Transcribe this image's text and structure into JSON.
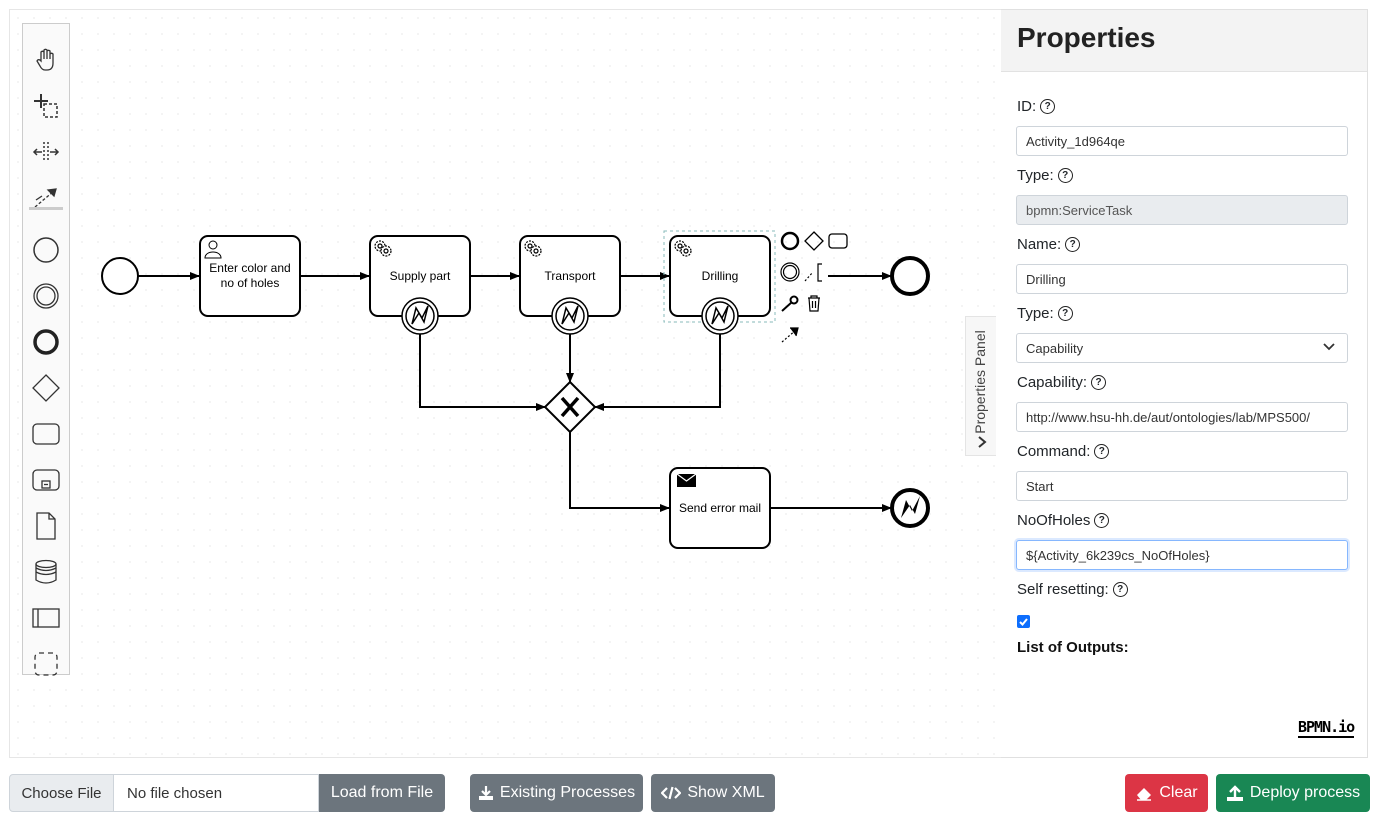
{
  "diagram": {
    "tasks": [
      {
        "label_line1": "Enter color and",
        "label_line2": "no of holes"
      },
      {
        "label": "Supply part"
      },
      {
        "label": "Transport"
      },
      {
        "label": "Drilling"
      },
      {
        "label": "Send error mail"
      }
    ],
    "gateway_symbol": "X"
  },
  "side_tab": {
    "label": "Properties Panel"
  },
  "properties": {
    "title": "Properties",
    "id_label": "ID:",
    "id_value": "Activity_1d964qe",
    "type_label": "Type:",
    "type_value": "bpmn:ServiceTask",
    "name_label": "Name:",
    "name_value": "Drilling",
    "type2_label": "Type:",
    "type2_value": "Capability",
    "capability_label": "Capability:",
    "capability_value": "http://www.hsu-hh.de/aut/ontologies/lab/MPS500/",
    "command_label": "Command:",
    "command_value": "Start",
    "noofholes_label": "NoOfHoles",
    "noofholes_value": "${Activity_6k239cs_NoOfHoles}",
    "self_resetting_label": "Self resetting:",
    "self_resetting_checked": true,
    "outputs_label": "List of Outputs:",
    "help_glyph": "?",
    "logo": "BPMN.io"
  },
  "footer": {
    "choose_file": "Choose File",
    "no_file": "No file chosen",
    "load_from_file": "Load from File",
    "existing_processes": "Existing Processes",
    "show_xml": "Show XML",
    "clear": "Clear",
    "deploy": "Deploy process"
  },
  "colors": {
    "danger": "#dc3545",
    "success": "#198754",
    "secondary": "#6c757d",
    "checkbox": "#0d6efd"
  },
  "palette_icons": [
    "hand-tool-icon",
    "lasso-tool-icon",
    "space-tool-icon",
    "global-connect-icon",
    "start-event-icon",
    "intermediate-event-icon",
    "end-event-icon",
    "gateway-icon",
    "task-icon",
    "subprocess-icon",
    "data-object-icon",
    "data-store-icon",
    "participant-icon",
    "group-icon"
  ]
}
